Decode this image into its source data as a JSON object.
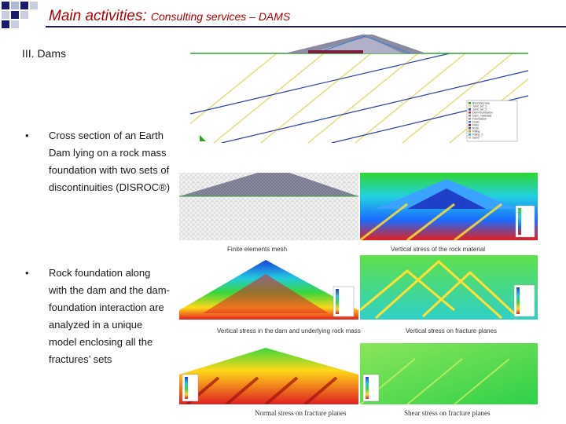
{
  "header": {
    "title_main": "Main activities: ",
    "title_sub": "Consulting services – DAMS"
  },
  "section": {
    "label": "III. Dams"
  },
  "bullets": [
    {
      "symbol": "•",
      "text": "Cross section of an Earth Dam lying on a rock mass foundation with two sets of discontinuities (DISROC®)"
    },
    {
      "symbol": "•",
      "text": "Rock foundation along with the dam and the dam-foundation interaction are analyzed in a unique model enclosing all the fractures’ sets"
    }
  ],
  "figures": {
    "legend_entries": [
      "Boundary line",
      "Joint_set_1",
      "Joint_set_2",
      "Dam-foundation",
      "Dam_materials",
      "Foundation",
      "Drain",
      "Filter",
      "Rock",
      "Filling",
      "Filling_2",
      "Sand"
    ],
    "captions": {
      "mesh": "Finite elements mesh",
      "vert_rock": "Vertical stress of the rock material",
      "vert_dam": "Vertical stress in the dam and underlying rock mass",
      "vert_fract": "Vertical stress on fracture planes",
      "normal": "Normal stress on fracture planes",
      "shear": "Shear stress on fracture planes"
    }
  },
  "colors": {
    "title": "#b00000",
    "accent_line": "#1a1a6e",
    "joint_set_1": "#e8d96a",
    "joint_set_2": "#2a3da8"
  }
}
